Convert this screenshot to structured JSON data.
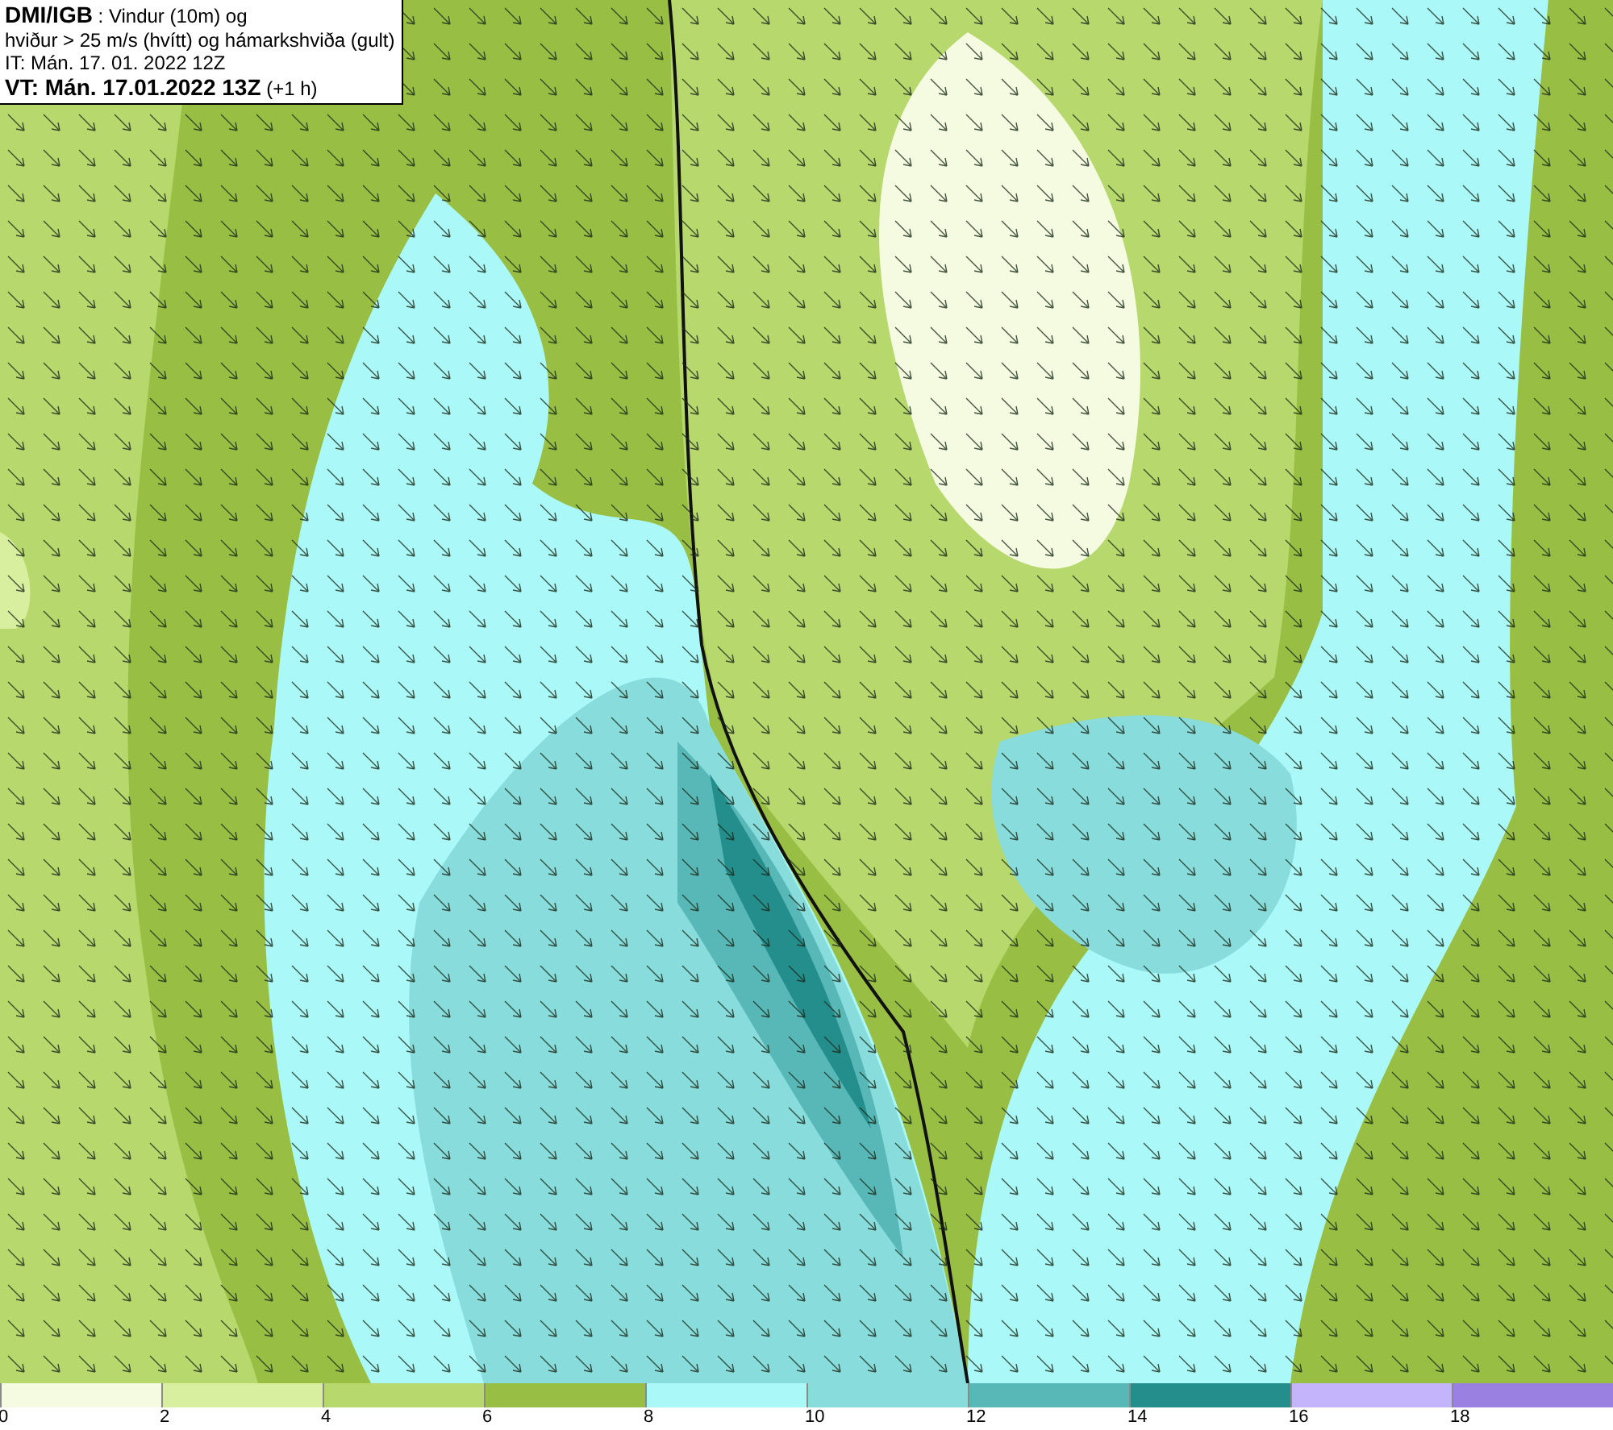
{
  "info_box": {
    "lines": [
      "**DMI/IGB** : Vindur (10m) og",
      "hviður > 25 m/s (hvítt) og hámarkshviða (gult)",
      "IT: Mán. 17. 01. 2022 12Z",
      "**VT: Mán. 17.01.2022 13Z** (+1 h)"
    ]
  },
  "legend": [
    {
      "label": "0",
      "color": "#f4fbe0"
    },
    {
      "label": "2",
      "color": "#d8efa0"
    },
    {
      "label": "4",
      "color": "#b6d86c"
    },
    {
      "label": "6",
      "color": "#98bf44"
    },
    {
      "label": "8",
      "color": "#aaf8f8"
    },
    {
      "label": "10",
      "color": "#88dcdc"
    },
    {
      "label": "12",
      "color": "#58b8b8"
    },
    {
      "label": "14",
      "color": "#248e8c"
    },
    {
      "label": "16",
      "color": "#c4b4fc"
    },
    {
      "label": "18",
      "color": "#9a80e0"
    }
  ]
}
